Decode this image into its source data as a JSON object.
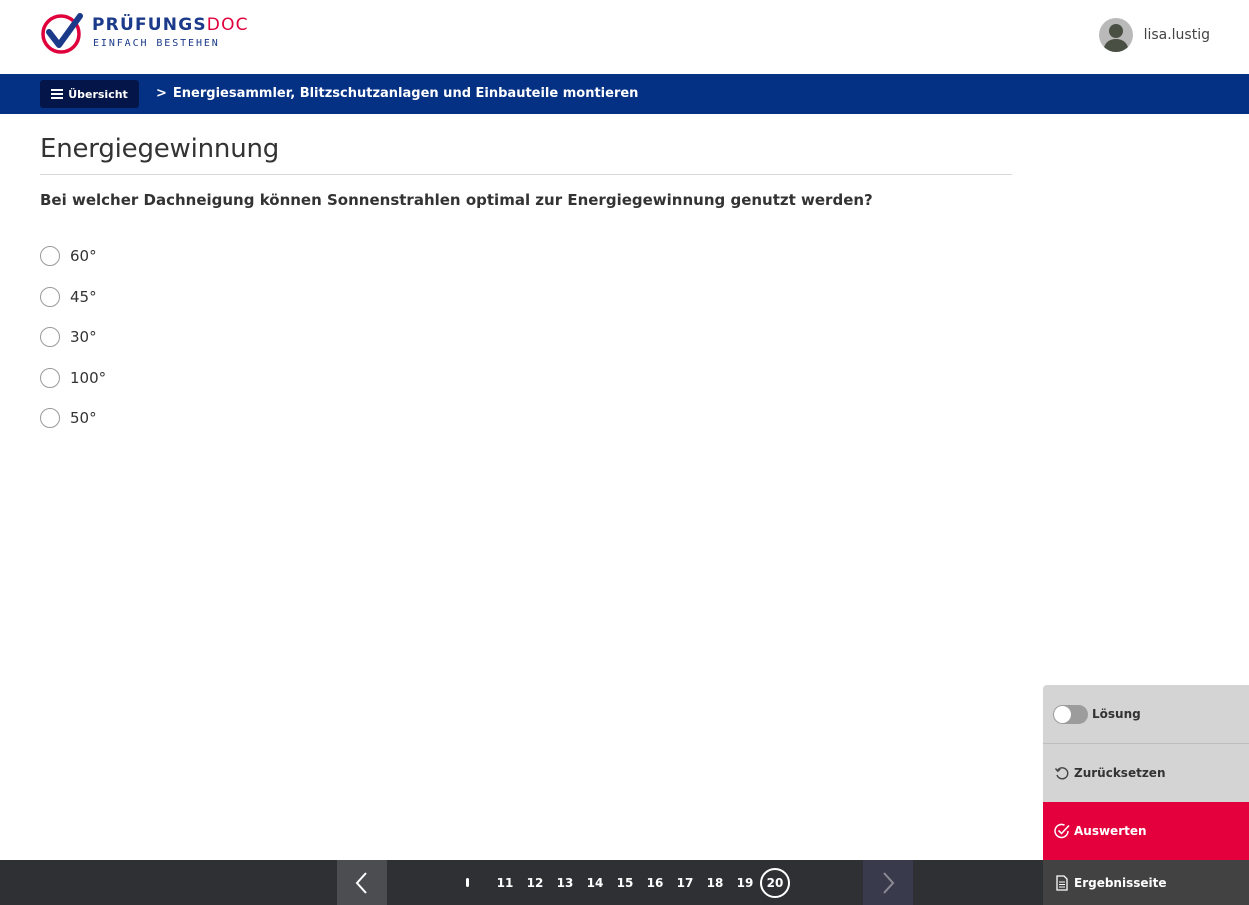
{
  "header": {
    "logo_brand": "PRÜFUNGS",
    "logo_brand_suffix": "DOC",
    "logo_tagline": "EINFACH BESTEHEN",
    "username": "lisa.lustig"
  },
  "navbar": {
    "overview_label": "Übersicht",
    "breadcrumb_separator": ">",
    "breadcrumb_current": "Energiesammler, Blitzschutzanlagen und Einbauteile montieren"
  },
  "main": {
    "title": "Energiegewinnung",
    "question": "Bei welcher Dachneigung können Sonnenstrahlen optimal zur Energiegewinnung genutzt werden?",
    "answers": [
      {
        "label": "60°"
      },
      {
        "label": "45°"
      },
      {
        "label": "30°"
      },
      {
        "label": "100°"
      },
      {
        "label": "50°"
      }
    ]
  },
  "side_panel": {
    "solution_label": "Lösung",
    "reset_label": "Zurücksetzen",
    "evaluate_label": "Auswerten",
    "results_label": "Ergebnisseite"
  },
  "pagination": {
    "pages": [
      "11",
      "12",
      "13",
      "14",
      "15",
      "16",
      "17",
      "18",
      "19",
      "20"
    ],
    "current": "20"
  },
  "colors": {
    "brand_blue": "#053185",
    "brand_red": "#e3003d",
    "overview_button": "#04154a",
    "footer_bg": "#2f3034"
  }
}
